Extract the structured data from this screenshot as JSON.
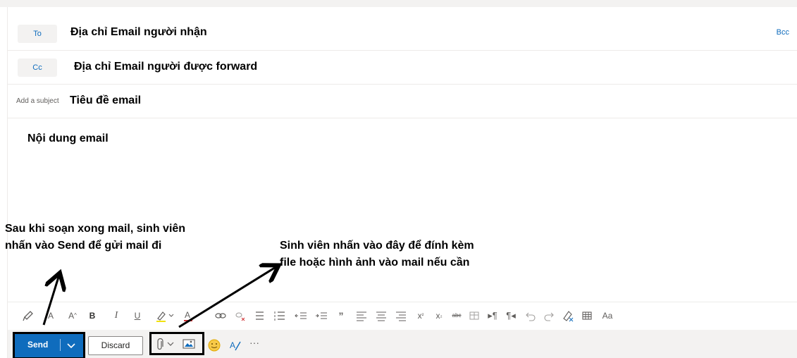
{
  "recipients": {
    "to_label": "To",
    "to_annotation": "Địa chỉ Email người nhận",
    "bcc_label": "Bcc",
    "cc_label": "Cc",
    "cc_annotation": "Địa chỉ Email người được forward"
  },
  "subject": {
    "placeholder": "Add a subject",
    "annotation": "Tiêu đề email"
  },
  "body": {
    "annotation": "Nội dung email"
  },
  "notes": {
    "send_note_line1": "Sau khi soạn xong mail, sinh viên",
    "send_note_line2": "nhấn vào Send để gửi mail đi",
    "attach_note_line1": "Sinh viên nhấn vào đây để đính kèm",
    "attach_note_line2": "file hoặc hình ảnh vào mail nếu cần"
  },
  "format_toolbar": {
    "icons": [
      "format-painter-icon",
      "font-icon",
      "font-size-icon",
      "bold-icon",
      "italic-icon",
      "underline-icon",
      "highlight-icon",
      "font-color-icon",
      "link-icon",
      "unlink-icon",
      "bullets-icon",
      "numbering-icon",
      "decrease-indent-icon",
      "increase-indent-icon",
      "quote-icon",
      "align-left-icon",
      "align-center-icon",
      "align-right-icon",
      "superscript-icon",
      "subscript-icon",
      "strikethrough-icon",
      "table-insert-icon",
      "ltr-icon",
      "rtl-icon",
      "undo-icon",
      "redo-icon",
      "clear-format-icon",
      "table-icon",
      "styles-icon"
    ],
    "styles_label": "Aa"
  },
  "actions": {
    "send_label": "Send",
    "discard_label": "Discard",
    "more_label": "···"
  },
  "colors": {
    "accent": "#0f6cbd",
    "toolbar_bg": "#f3f2f1"
  }
}
